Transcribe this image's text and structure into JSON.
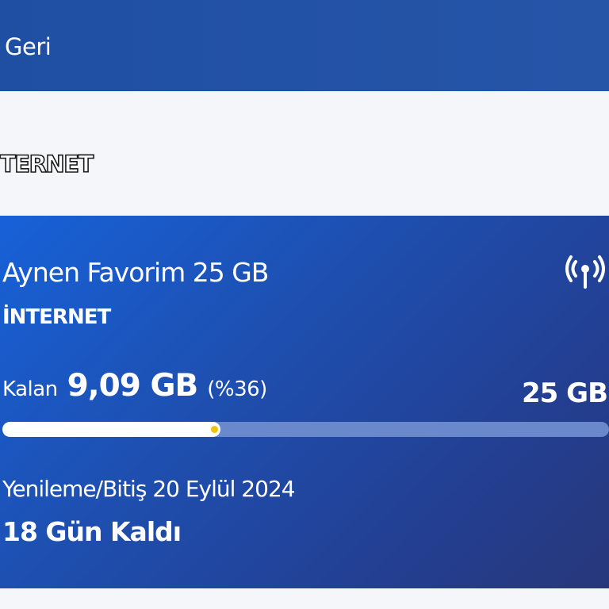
{
  "header": {
    "back_label": "Geri"
  },
  "section": {
    "title": "TERNET"
  },
  "card": {
    "plan_name": "Aynen Favorim 25 GB",
    "plan_type": "İNTERNET",
    "remaining_label": "Kalan",
    "remaining_value": "9,09 GB",
    "remaining_pct": "(%36)",
    "total_value": "25 GB",
    "usage_fraction": 0.36,
    "renewal_text": "Yenileme/Bitiş 20 Eylül 2024",
    "days_left": "18 Gün Kaldı",
    "icon": "antenna-signal-icon"
  },
  "colors": {
    "header_bg": "#2352a6",
    "card_gradient_start": "#1761d8",
    "card_gradient_end": "#28377a",
    "progress_fill": "#ffffff",
    "progress_track": "#6a88cc",
    "progress_marker": "#f2c400"
  }
}
